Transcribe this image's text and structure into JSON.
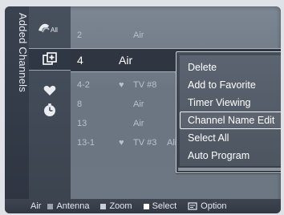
{
  "panel": {
    "title": "Added Channels"
  },
  "icons": {
    "all_label": "All",
    "list": [
      "all-channels-icon",
      "added-channel-icon",
      "favorite-heart-icon",
      "timer-clock-icon"
    ]
  },
  "selected_channel": {
    "number": "4",
    "name": "Air"
  },
  "channels": [
    {
      "number": "2",
      "fav": "",
      "name": "Air",
      "program": ""
    },
    {
      "number": "4-2",
      "fav": "♥",
      "name": "TV #8",
      "program": ""
    },
    {
      "number": "8",
      "fav": "",
      "name": "Air",
      "program": ""
    },
    {
      "number": "13",
      "fav": "",
      "name": "Air",
      "program": ""
    },
    {
      "number": "13-1",
      "fav": "♥",
      "name": "TV #3",
      "program": "Alice"
    }
  ],
  "menu": {
    "items": [
      "Delete",
      "Add to Favorite",
      "Timer Viewing",
      "Channel Name Edit",
      "Select All",
      "Auto Program"
    ],
    "focused_index": 3
  },
  "footer": {
    "source": "Air",
    "antenna": "Antenna",
    "zoom": "Zoom",
    "select": "Select",
    "option": "Option",
    "colors": {
      "antenna": "#9aa3ad",
      "zoom": "#c9cfd6",
      "select": "#ffffff"
    }
  }
}
